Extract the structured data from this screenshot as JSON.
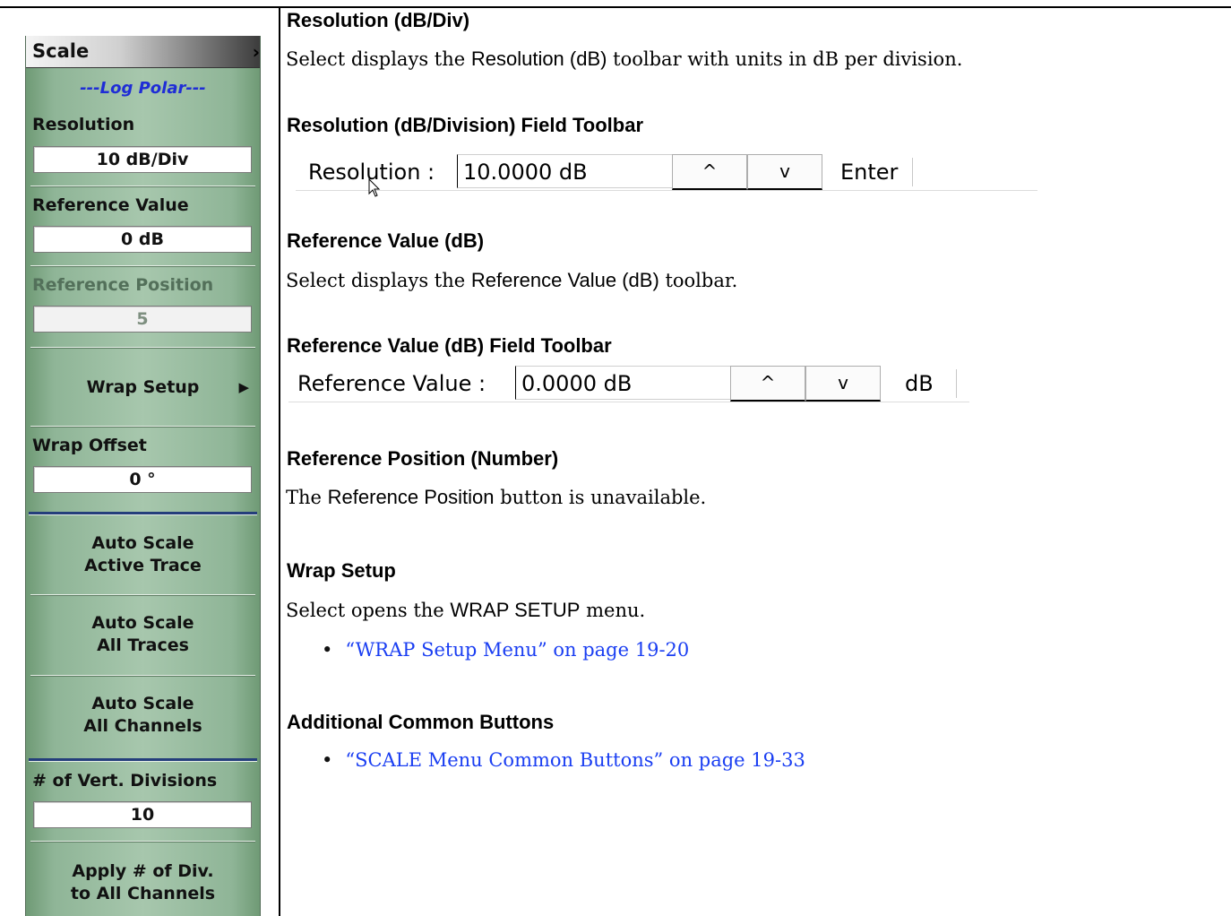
{
  "menu": {
    "title": "Scale",
    "section": "---Log Polar---",
    "resolution": {
      "label": "Resolution",
      "value": "10  dB/Div"
    },
    "reference_value": {
      "label": "Reference Value",
      "value": "0  dB"
    },
    "reference_position": {
      "label": "Reference Position",
      "value": "5"
    },
    "wrap_setup": "Wrap Setup",
    "wrap_offset": {
      "label": "Wrap Offset",
      "value": "0 °"
    },
    "auto_scale_active": [
      "Auto Scale",
      "Active Trace"
    ],
    "auto_scale_all_traces": [
      "Auto Scale",
      "All Traces"
    ],
    "auto_scale_all_channels": [
      "Auto Scale",
      "All Channels"
    ],
    "vert_divisions": {
      "label": "# of Vert. Divisions",
      "value": "10"
    },
    "apply_div": [
      "Apply # of Div.",
      "to All Channels"
    ]
  },
  "doc": {
    "h_resolution": "Resolution (dB/Div)",
    "p_resolution_1": "Select displays the ",
    "p_resolution_2": "Resolution (dB)",
    "p_resolution_3": " toolbar with units in dB per division.",
    "h_resolution_toolbar": "Resolution (dB/Division) Field Toolbar",
    "toolbar1": {
      "label": "Resolution  :",
      "value": "10.0000  dB",
      "up": "^",
      "down": "v",
      "action": "Enter"
    },
    "h_refval": "Reference Value (dB)",
    "p_refval_1": "Select displays the ",
    "p_refval_2": "Reference Value (dB)",
    "p_refval_3": " toolbar.",
    "h_refval_toolbar": "Reference Value (dB) Field Toolbar",
    "toolbar2": {
      "label": "Reference Value  :",
      "value": "0.0000  dB",
      "up": "^",
      "down": "v",
      "unit": "dB"
    },
    "h_refpos": "Reference Position (Number)",
    "p_refpos_1": "The ",
    "p_refpos_2": "Reference Position",
    "p_refpos_3": " button is unavailable.",
    "h_wrap": "Wrap Setup",
    "p_wrap_1": "Select opens the ",
    "p_wrap_2": "WRAP SETUP",
    "p_wrap_3": " menu.",
    "link_wrap": "“WRAP Setup Menu” on page 19-20",
    "h_common": "Additional Common Buttons",
    "link_common": "“SCALE Menu Common Buttons” on page 19-33"
  },
  "colors": {
    "menu_green": "#a7c7ad",
    "link_blue": "#1a3ef2",
    "section_blue": "#1f2dd6",
    "separator_navy": "#243e7b"
  }
}
